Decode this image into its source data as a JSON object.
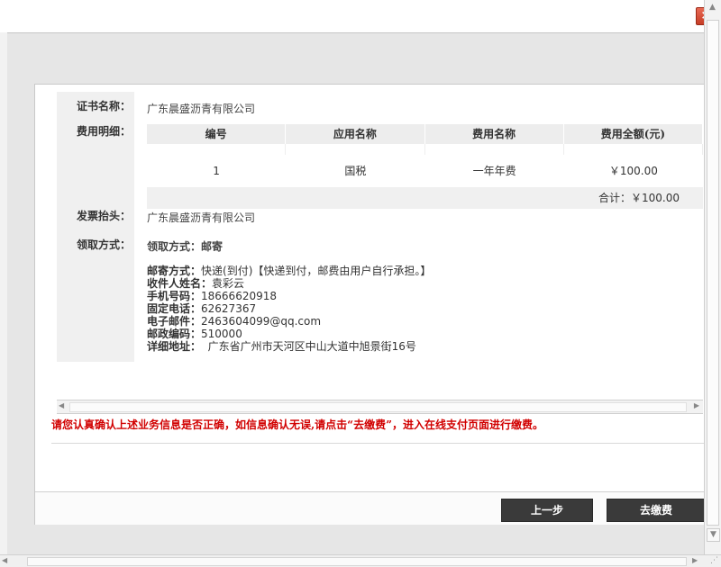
{
  "window": {
    "close_label": "×"
  },
  "form": {
    "cert_label": "证书名称：",
    "cert_value": "广东晨盛沥青有限公司",
    "fee_label": "费用明细：",
    "invoice_label": "发票抬头：",
    "invoice_value": "广东晨盛沥青有限公司",
    "pickup_label": "领取方式：",
    "pickup_value": "领取方式：邮寄"
  },
  "fee_table": {
    "headers": [
      "编号",
      "应用名称",
      "费用名称",
      "费用全额(元)"
    ],
    "rows": [
      [
        "1",
        "国税",
        "一年年费",
        "￥100.00"
      ]
    ],
    "total": "合计：￥100.00"
  },
  "mailing": {
    "method_label": "邮寄方式：",
    "method_value": "快递(到付)【快递到付，邮费由用户自行承担。】",
    "name_label": "收件人姓名：",
    "name_value": "袁彩云",
    "mobile_label": "手机号码：",
    "mobile_value": "18666620918",
    "phone_label": "固定电话：",
    "phone_value": "62627367",
    "email_label": "电子邮件：",
    "email_value": "2463604099@qq.com",
    "zip_label": "邮政编码：",
    "zip_value": "510000",
    "address_label": "详细地址：",
    "address_value": "广东省广州市天河区中山大道中旭景街16号"
  },
  "notice": "请您认真确认上述业务信息是否正确，如信息确认无误,请点击“去缴费”，进入在线支付页面进行缴费。",
  "buttons": {
    "prev": "上一步",
    "pay": "去缴费"
  }
}
